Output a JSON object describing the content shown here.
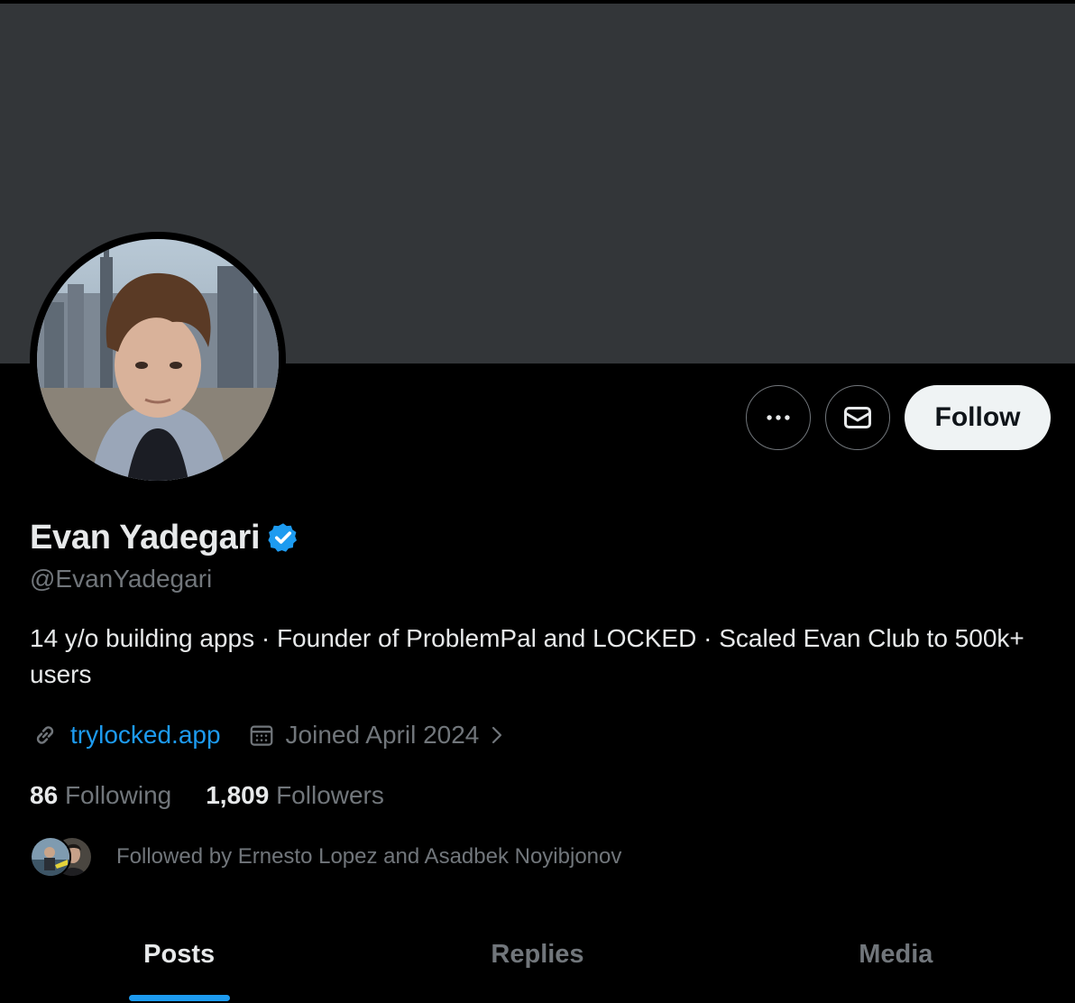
{
  "profile": {
    "display_name": "Evan Yadegari",
    "handle": "@EvanYadegari",
    "verified": true,
    "bio": "14 y/o building apps · Founder of ProblemPal and LOCKED · Scaled Evan Club to 500k+ users",
    "website": "trylocked.app",
    "joined": "Joined April 2024"
  },
  "actions": {
    "more_icon": "more-horizontal-icon",
    "message_icon": "envelope-icon",
    "follow_label": "Follow"
  },
  "stats": {
    "following_count": "86",
    "following_label": "Following",
    "followers_count": "1,809",
    "followers_label": "Followers"
  },
  "followed_by": {
    "text": "Followed by Ernesto Lopez and Asadbek Noyibjonov"
  },
  "tabs": [
    {
      "label": "Posts",
      "active": true
    },
    {
      "label": "Replies",
      "active": false
    },
    {
      "label": "Media",
      "active": false
    }
  ],
  "colors": {
    "background": "#000000",
    "banner": "#333639",
    "accent": "#1d9bf0",
    "secondary_text": "#71767b",
    "follow_button_bg": "#eff3f4"
  }
}
